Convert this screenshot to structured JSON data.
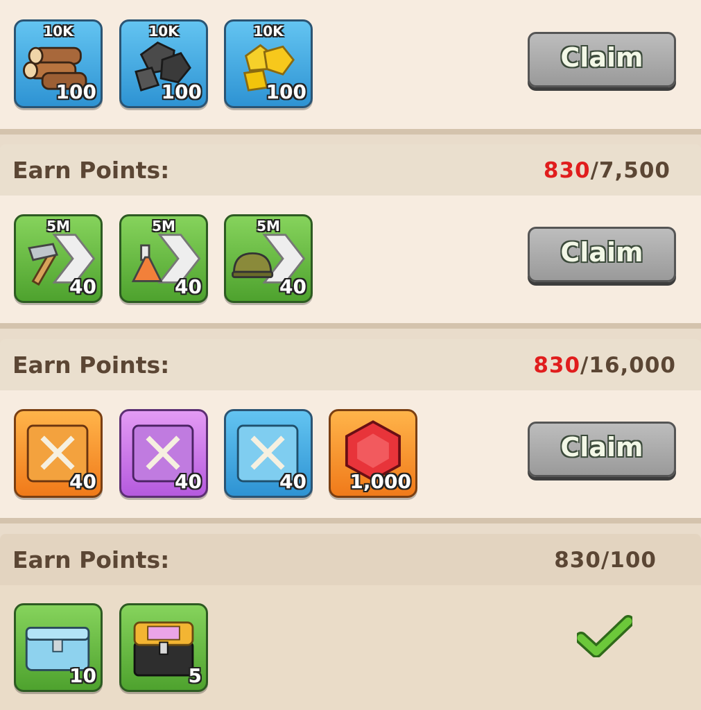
{
  "sections": [
    {
      "rewards": [
        {
          "icon": "wood-logs-icon",
          "tag": "10K",
          "qty": "100"
        },
        {
          "icon": "coal-ore-icon",
          "tag": "10K",
          "qty": "100"
        },
        {
          "icon": "gold-ore-icon",
          "tag": "10K",
          "qty": "100"
        }
      ],
      "claim_label": "Claim"
    },
    {
      "header": {
        "label": "Earn Points:",
        "current": "830",
        "goal": "/7,500"
      },
      "rewards": [
        {
          "icon": "build-speedup-icon",
          "tag": "5M",
          "qty": "40"
        },
        {
          "icon": "research-speedup-icon",
          "tag": "5M",
          "qty": "40"
        },
        {
          "icon": "training-speedup-icon",
          "tag": "5M",
          "qty": "40"
        }
      ],
      "claim_label": "Claim"
    },
    {
      "header": {
        "label": "Earn Points:",
        "current": "830",
        "goal": "/16,000"
      },
      "rewards": [
        {
          "icon": "orange-skill-book-icon",
          "tag": "",
          "qty": "40"
        },
        {
          "icon": "purple-skill-book-icon",
          "tag": "",
          "qty": "40"
        },
        {
          "icon": "blue-skill-book-icon",
          "tag": "",
          "qty": "40"
        },
        {
          "icon": "ruby-gem-icon",
          "tag": "",
          "qty": "1,000"
        }
      ],
      "claim_label": "Claim"
    },
    {
      "header": {
        "label": "Earn Points:",
        "current": "830",
        "goal": "/100"
      },
      "rewards": [
        {
          "icon": "blue-chest-icon",
          "tag": "",
          "qty": "10"
        },
        {
          "icon": "gold-chest-icon",
          "tag": "",
          "qty": "5"
        }
      ],
      "status": "claimed-checkmark"
    }
  ],
  "colors": {
    "progress_current": "#e01d1d",
    "header_text": "#5b4634",
    "panel_bg": "#f7ece0"
  }
}
